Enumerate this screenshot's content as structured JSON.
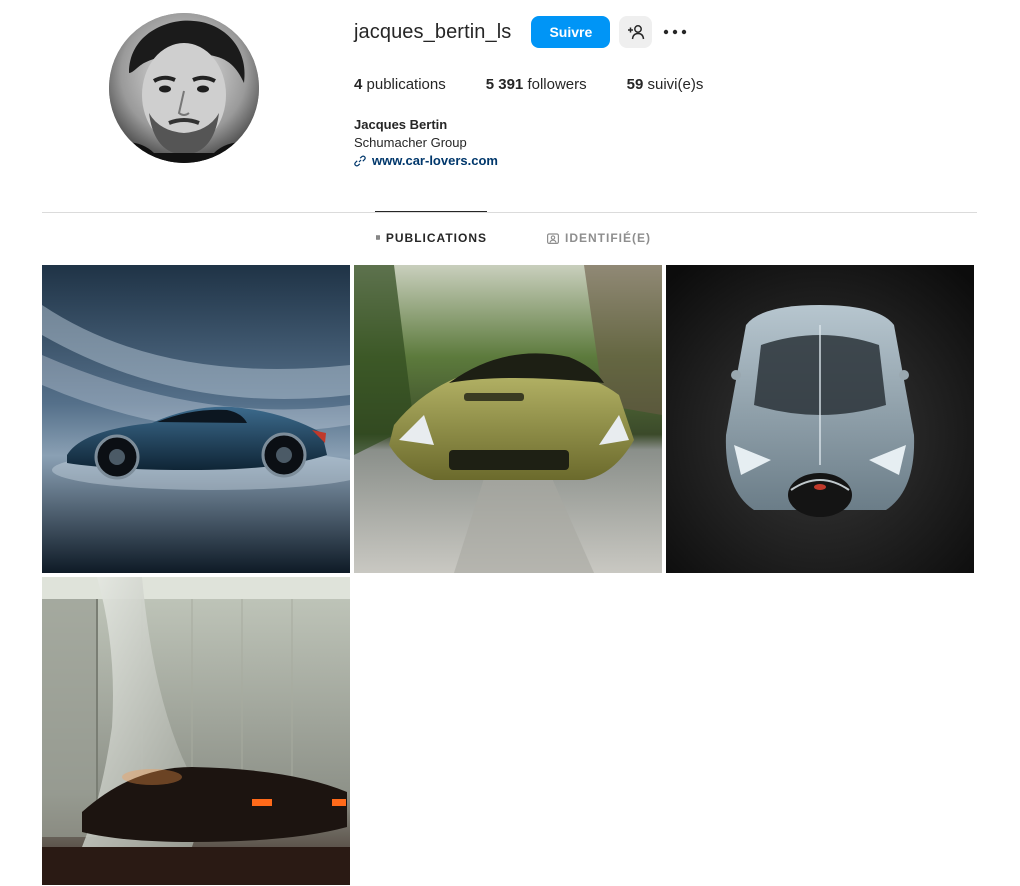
{
  "profile": {
    "username": "jacques_bertin_ls",
    "follow_label": "Suivre",
    "stats": [
      {
        "count": "4",
        "label": "publications"
      },
      {
        "count": "5 391",
        "label": "followers"
      },
      {
        "count": "59",
        "label": "suivi(e)s"
      }
    ],
    "full_name": "Jacques Bertin",
    "category": "Schumacher Group",
    "website": "www.car-lovers.com"
  },
  "tabs": [
    {
      "label": "PUBLICATIONS",
      "icon": "grid-icon",
      "active": true
    },
    {
      "label": "IDENTIFIÉ(E)",
      "icon": "tagged-icon",
      "active": false
    }
  ],
  "posts": [
    {
      "subject": "blue hypercar side view",
      "icon": "post-image"
    },
    {
      "subject": "green supercar on road",
      "icon": "post-image"
    },
    {
      "subject": "silver hypercar top view",
      "icon": "post-image"
    },
    {
      "subject": "car under cloth in garage",
      "icon": "post-image"
    }
  ],
  "colors": {
    "accent": "#0095f6",
    "text": "#262626",
    "muted": "#8e8e8e",
    "link": "#00376b",
    "divider": "#dbdbdb"
  }
}
